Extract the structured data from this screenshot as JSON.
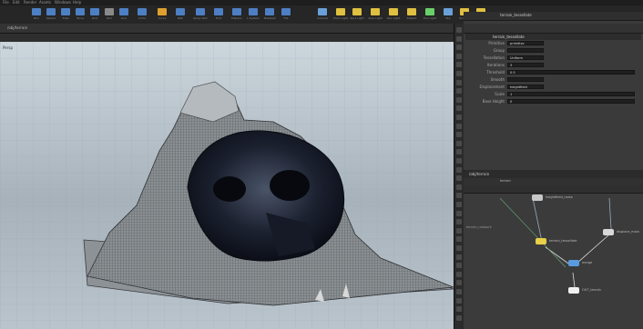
{
  "menubar": {
    "items": [
      "File",
      "Edit",
      "Render",
      "Assets",
      "Windows",
      "Help"
    ]
  },
  "shelf": {
    "tools": [
      {
        "icon": "box-icon",
        "label": "Box",
        "color": "#4d7fc4"
      },
      {
        "icon": "sphere-icon",
        "label": "Sphere",
        "color": "#4d7fc4"
      },
      {
        "icon": "tube-icon",
        "label": "Tube",
        "color": "#4d7fc4"
      },
      {
        "icon": "torus-icon",
        "label": "Torus",
        "color": "#4d7fc4"
      },
      {
        "icon": "grid-icon",
        "label": "Grid",
        "color": "#4d7fc4"
      },
      {
        "icon": "null-icon",
        "label": "Null",
        "color": "#8a8a8a"
      },
      {
        "icon": "line-icon",
        "label": "Line",
        "color": "#4d7fc4"
      },
      {
        "icon": "circle-icon",
        "label": "Circle",
        "color": "#4d7fc4"
      },
      {
        "icon": "curve-icon",
        "label": "Curve",
        "color": "#e0a030"
      },
      {
        "icon": "path-icon",
        "label": "Path",
        "color": "#4d7fc4"
      },
      {
        "icon": "spray-icon",
        "label": "Spray Paint",
        "color": "#4d7fc4"
      },
      {
        "icon": "font-icon",
        "label": "Font",
        "color": "#4d7fc4"
      },
      {
        "icon": "platonic-icon",
        "label": "Platonic",
        "color": "#4d7fc4"
      },
      {
        "icon": "lsystem-icon",
        "label": "L-System",
        "color": "#4d7fc4"
      },
      {
        "icon": "metaball-icon",
        "label": "Metaball",
        "color": "#4d7fc4"
      },
      {
        "icon": "file-icon",
        "label": "File",
        "color": "#4d7fc4"
      }
    ],
    "right_tools": [
      {
        "icon": "camera-icon",
        "label": "Camera",
        "color": "#6aa0d8"
      },
      {
        "icon": "pointlight-icon",
        "label": "Point Light",
        "color": "#e0c040"
      },
      {
        "icon": "spotlight-icon",
        "label": "Spot Light",
        "color": "#e0c040"
      },
      {
        "icon": "arealight-icon",
        "label": "Area Light",
        "color": "#e0c040"
      },
      {
        "icon": "geolight-icon",
        "label": "Geo Light",
        "color": "#e0c040"
      },
      {
        "icon": "distant-icon",
        "label": "Distant",
        "color": "#e0c040"
      },
      {
        "icon": "envlight-icon",
        "label": "Env Light",
        "color": "#6ad06a"
      },
      {
        "icon": "sky-icon",
        "label": "Sky",
        "color": "#6aa0d8"
      },
      {
        "icon": "gi-icon",
        "label": "GI Light",
        "color": "#e0c040"
      },
      {
        "icon": "caustic-icon",
        "label": "Caustic",
        "color": "#e0c040"
      }
    ]
  },
  "pathbar": {
    "crumb": "/obj/terrain"
  },
  "viewport": {
    "label": "Persp"
  },
  "params": {
    "tab": "terrain_tessellate",
    "title": "terrain_tessellate",
    "rows": [
      {
        "label": "Primitive",
        "value": "primitive"
      },
      {
        "label": "Group",
        "value": ""
      },
      {
        "label": "Tessellation",
        "value": "Uniform"
      },
      {
        "label": "Iterations",
        "value": "3"
      },
      {
        "label": "Threshold",
        "value": "0.5"
      },
      {
        "label": "Smooth",
        "value": ""
      },
      {
        "label": "Displacement",
        "value": "heightfield"
      },
      {
        "label": "Scale",
        "value": "1"
      },
      {
        "label": "Base Height",
        "value": "0"
      }
    ]
  },
  "network": {
    "tab": "/obj/terrain",
    "path": "terrain",
    "nodes": [
      {
        "label": "heightfield_noise",
        "color": "#c8c8c8"
      },
      {
        "label": "terrain_tessellate",
        "color": "#e8d048"
      },
      {
        "label": "displace_main",
        "color": "#d8d8d8"
      },
      {
        "label": "merge",
        "color": "#5a9be0"
      },
      {
        "label": "OUT_terrain",
        "color": "#f0f0f0"
      }
    ],
    "side_label": "terrain_network"
  }
}
